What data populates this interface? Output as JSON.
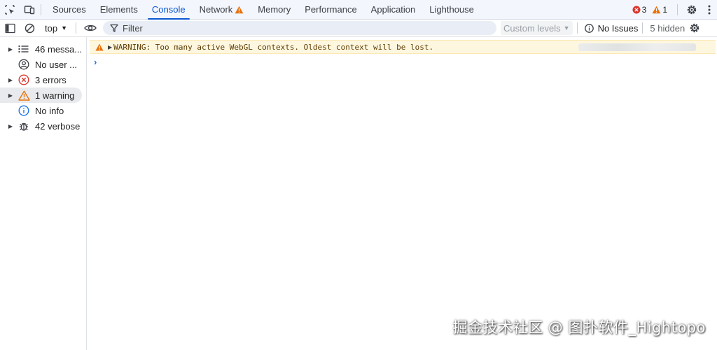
{
  "tabbar": {
    "tabs": [
      {
        "label": "Sources"
      },
      {
        "label": "Elements"
      },
      {
        "label": "Console"
      },
      {
        "label": "Network"
      },
      {
        "label": "Memory"
      },
      {
        "label": "Performance"
      },
      {
        "label": "Application"
      },
      {
        "label": "Lighthouse"
      }
    ],
    "active_tab": "Console",
    "error_count": "3",
    "warning_count": "1"
  },
  "toolbar": {
    "context": "top",
    "filter_placeholder": "Filter",
    "levels_label": "Custom levels",
    "issues_label": "No Issues",
    "hidden_label": "5 hidden"
  },
  "sidebar": {
    "items": [
      {
        "label": "46 messa...",
        "icon": "list-icon",
        "expandable": true
      },
      {
        "label": "No user ...",
        "icon": "user-icon",
        "expandable": false
      },
      {
        "label": "3 errors",
        "icon": "error-icon",
        "expandable": true
      },
      {
        "label": "1 warning",
        "icon": "warning-icon",
        "expandable": true,
        "selected": true
      },
      {
        "label": "No info",
        "icon": "info-icon",
        "expandable": false
      },
      {
        "label": "42 verbose",
        "icon": "bug-icon",
        "expandable": true
      }
    ]
  },
  "console": {
    "warning_message": "WARNING: Too many active WebGL contexts. Oldest context will be lost.",
    "prompt_symbol": "›"
  },
  "watermark": "掘金技术社区 @ 图扑软件_Hightopo",
  "colors": {
    "accent": "#0b57d0",
    "error": "#dc362e",
    "warning": "#e8710a",
    "warning_bg": "#fef7e0"
  }
}
